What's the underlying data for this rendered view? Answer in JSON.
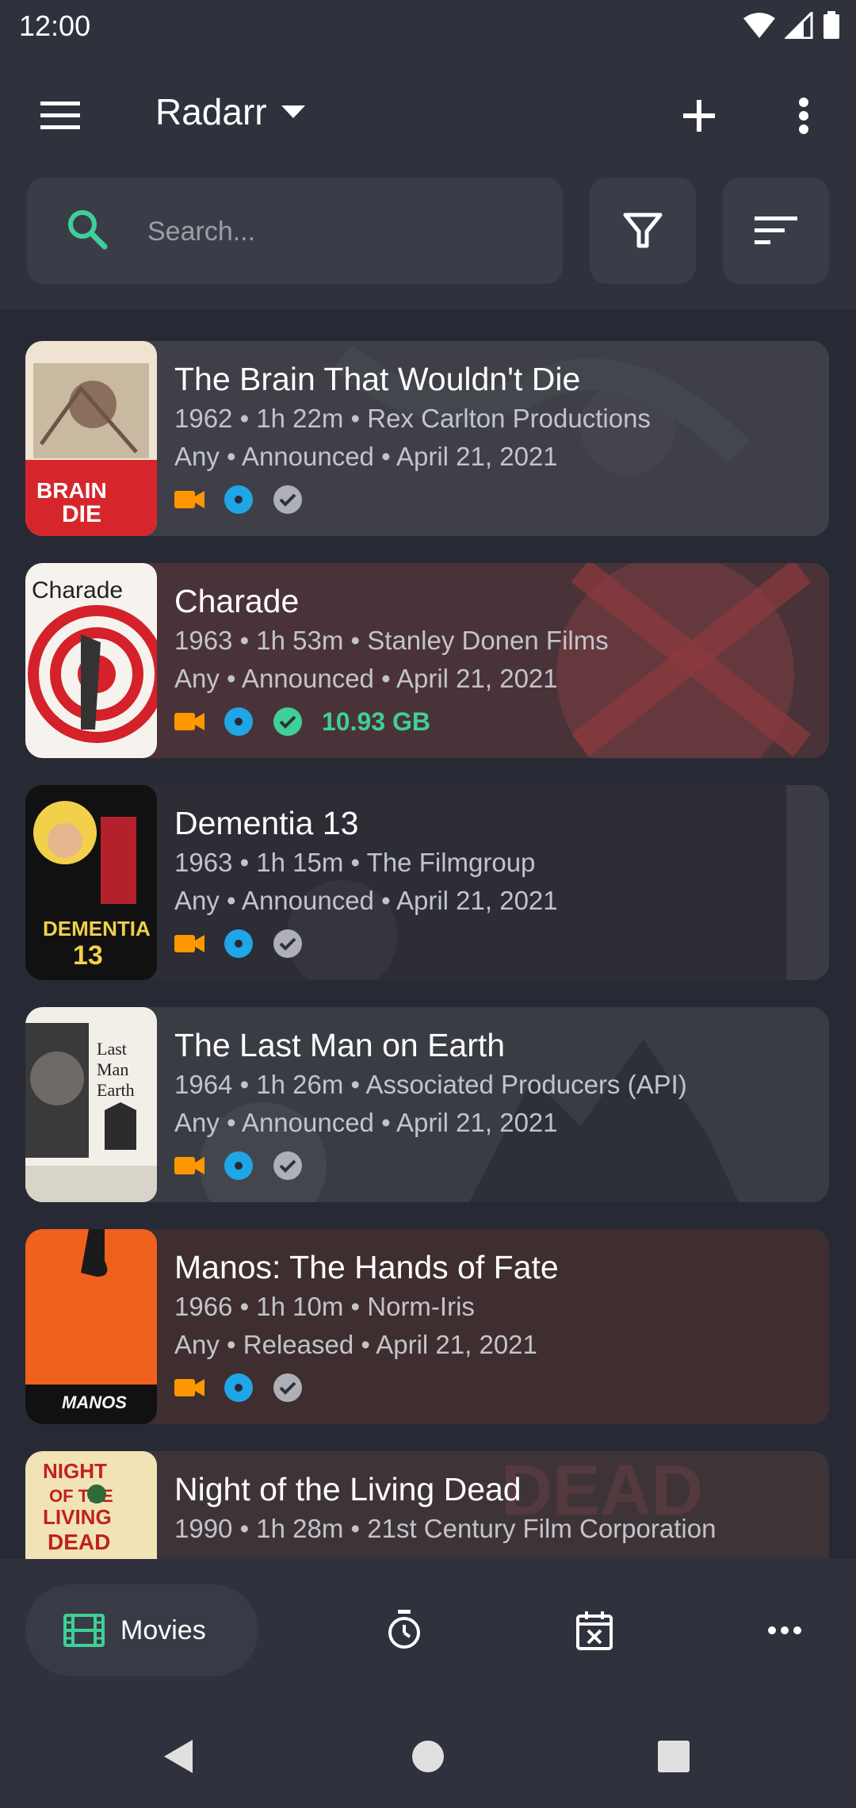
{
  "status_bar": {
    "time": "12:00"
  },
  "app_bar": {
    "title": "Radarr"
  },
  "search": {
    "placeholder": "Search..."
  },
  "movies": [
    {
      "title": "The Brain That Wouldn't Die",
      "line1": "1962 • 1h 22m • Rex Carlton Productions",
      "line2": "Any • Announced • April 21, 2021",
      "size": "",
      "downloaded": false
    },
    {
      "title": "Charade",
      "line1": "1963 • 1h 53m • Stanley Donen Films",
      "line2": "Any • Announced • April 21, 2021",
      "size": "10.93 GB",
      "downloaded": true
    },
    {
      "title": "Dementia 13",
      "line1": "1963 • 1h 15m • The Filmgroup",
      "line2": "Any • Announced • April 21, 2021",
      "size": "",
      "downloaded": false
    },
    {
      "title": "The Last Man on Earth",
      "line1": "1964 • 1h 26m • Associated Producers (API)",
      "line2": "Any • Announced • April 21, 2021",
      "size": "",
      "downloaded": false
    },
    {
      "title": "Manos: The Hands of Fate",
      "line1": "1966 • 1h 10m • Norm-Iris",
      "line2": "Any • Released • April 21, 2021",
      "size": "",
      "downloaded": false
    },
    {
      "title": "Night of the Living Dead",
      "line1": "1990 • 1h 28m • 21st Century Film Corporation",
      "line2": "",
      "size": "",
      "downloaded": false
    }
  ],
  "bottom_nav": {
    "movies_label": "Movies"
  },
  "colors": {
    "accent_green": "#3fcf98",
    "monitor_orange": "#ff9800",
    "disc_blue": "#1fa6e6",
    "check_grey": "#aeb0b6"
  },
  "icons": [
    "menu-icon",
    "dropdown-arrow-icon",
    "plus-icon",
    "more-vert-icon",
    "search-icon",
    "filter-icon",
    "sort-icon",
    "video-camera-icon",
    "disc-icon",
    "check-circle-icon",
    "film-icon",
    "timer-icon",
    "calendar-icon",
    "more-horiz-icon"
  ]
}
